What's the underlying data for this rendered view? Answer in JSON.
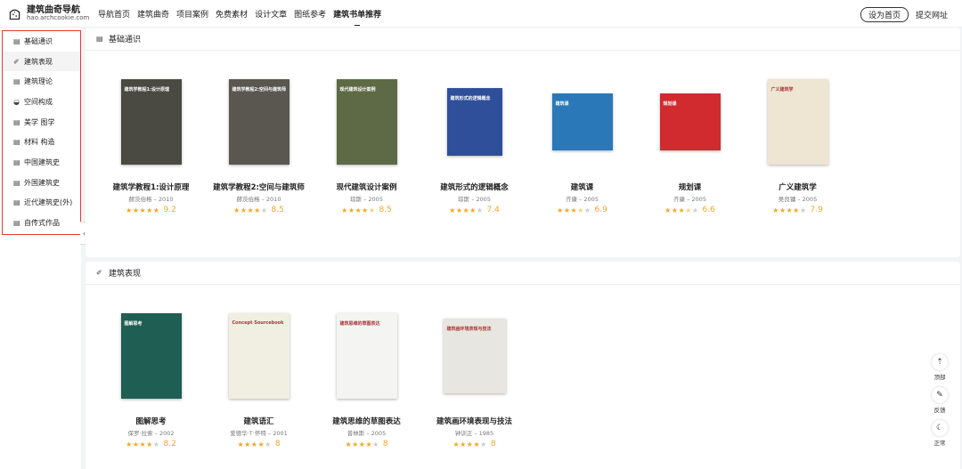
{
  "header": {
    "logo_title": "建筑曲奇导航",
    "logo_sub": "hao.archcookie.com",
    "nav": [
      "导航首页",
      "建筑曲奇",
      "项目案例",
      "免费素材",
      "设计文章",
      "图纸参考",
      "建筑书单推荐"
    ],
    "set_home": "设为首页",
    "submit": "提交网址"
  },
  "sidebar": {
    "items": [
      {
        "label": "基础通识",
        "icon": "book-icon"
      },
      {
        "label": "建筑表现",
        "icon": "pen-icon"
      },
      {
        "label": "建筑理论",
        "icon": "book-icon"
      },
      {
        "label": "空间构成",
        "icon": "layers-icon"
      },
      {
        "label": "美学 图学",
        "icon": "book-icon"
      },
      {
        "label": "材料 构造",
        "icon": "book-icon"
      },
      {
        "label": "中国建筑史",
        "icon": "book-icon"
      },
      {
        "label": "外国建筑史",
        "icon": "book-icon"
      },
      {
        "label": "近代建筑史(外)",
        "icon": "book-icon"
      },
      {
        "label": "自传式作品",
        "icon": "book-icon"
      }
    ]
  },
  "sections": [
    {
      "title": "基础通识",
      "books": [
        {
          "title": "建筑学教程1:设计原理",
          "meta": "赫茨伯格 – 2010",
          "stars": [
            1,
            1,
            1,
            1,
            1
          ],
          "score": "9.2",
          "cover_text": "建筑学教程1:设计原理",
          "cover_color": "#4a4a42"
        },
        {
          "title": "建筑学教程2:空间与建筑师",
          "meta": "赫茨伯格 – 2010",
          "stars": [
            1,
            1,
            1,
            1,
            0
          ],
          "score": "8.5",
          "cover_text": "建筑学教程2:空间与建筑师",
          "cover_color": "#5a5650"
        },
        {
          "title": "现代建筑设计案例",
          "meta": "琼斯 – 2005",
          "stars": [
            1,
            1,
            1,
            1,
            0.5
          ],
          "score": "8.5",
          "cover_text": "现代建筑设计案例",
          "cover_color": "#5d6a45"
        },
        {
          "title": "建筑形式的逻辑概念",
          "meta": "琼斯 – 2005",
          "stars": [
            1,
            1,
            1,
            1,
            0
          ],
          "score": "7.4",
          "cover_text": "建筑形式的逻辑概念",
          "cover_color": "#2f4f9a"
        },
        {
          "title": "建筑课",
          "meta": "齐康 – 2005",
          "stars": [
            1,
            1,
            1,
            0.5,
            0
          ],
          "score": "6.9",
          "cover_text": "建筑课",
          "cover_color": "#2a78b8"
        },
        {
          "title": "规划课",
          "meta": "齐康 – 2005",
          "stars": [
            1,
            1,
            1,
            0.5,
            0
          ],
          "score": "6.6",
          "cover_text": "规划课",
          "cover_color": "#d12a2f"
        },
        {
          "title": "广义建筑学",
          "meta": "吴良镛 – 2005",
          "stars": [
            1,
            1,
            1,
            1,
            0
          ],
          "score": "7.9",
          "cover_text": "广义建筑学",
          "cover_color": "#eee5d3"
        }
      ]
    },
    {
      "title": "建筑表现",
      "books": [
        {
          "title": "图解思考",
          "meta": "保罗·拉索 – 2002",
          "stars": [
            1,
            1,
            1,
            1,
            0
          ],
          "score": "8.2",
          "cover_text": "图解思考",
          "cover_color": "#1f5e53"
        },
        {
          "title": "建筑语汇",
          "meta": "爱德华·T·怀特 – 2001",
          "stars": [
            1,
            1,
            1,
            1,
            0
          ],
          "score": "8",
          "cover_text": "Concept Sourcebook",
          "cover_color": "#f1efe2"
        },
        {
          "title": "建筑思维的草图表达",
          "meta": "普林斯 – 2005",
          "stars": [
            1,
            1,
            1,
            1,
            0
          ],
          "score": "8",
          "cover_text": "建筑思维的草图表达",
          "cover_color": "#f4f4f2"
        },
        {
          "title": "建筑画环境表现与技法",
          "meta": "钟训正 – 1985",
          "stars": [
            1,
            1,
            1,
            1,
            0
          ],
          "score": "8",
          "cover_text": "建筑画环境表现与技法",
          "cover_color": "#e8e6e0"
        }
      ]
    }
  ],
  "tools": [
    {
      "label": "顶部",
      "icon": "rocket-icon",
      "glyph": "⇡"
    },
    {
      "label": "反馈",
      "icon": "pencil-icon",
      "glyph": "✎"
    },
    {
      "label": "正常",
      "icon": "moon-icon",
      "glyph": "☾"
    }
  ]
}
